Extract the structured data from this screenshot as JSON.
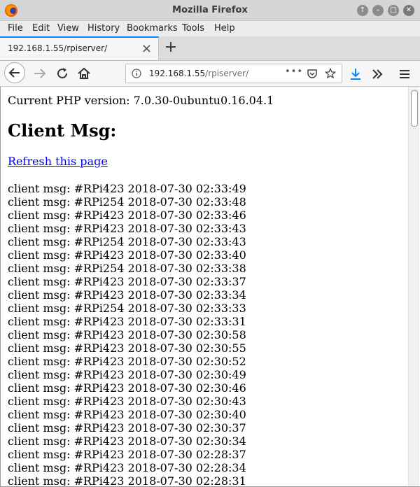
{
  "window": {
    "title": "Mozilla Firefox"
  },
  "menu": [
    "File",
    "Edit",
    "View",
    "History",
    "Bookmarks",
    "Tools",
    "Help"
  ],
  "tab": {
    "label": "192.168.1.55/rpiserver/"
  },
  "urlbar": {
    "host": "192.168.1.55",
    "path": "/rpiserver/",
    "more": "•••"
  },
  "page": {
    "php_version": "Current PHP version: 7.0.30-0ubuntu0.16.04.1",
    "heading": "Client Msg:",
    "refresh_link": "Refresh this page",
    "messages": [
      "client msg: #RPi423 2018-07-30 02:33:49",
      "client msg: #RPi254 2018-07-30 02:33:48",
      "client msg: #RPi423 2018-07-30 02:33:46",
      "client msg: #RPi423 2018-07-30 02:33:43",
      "client msg: #RPi254 2018-07-30 02:33:43",
      "client msg: #RPi423 2018-07-30 02:33:40",
      "client msg: #RPi254 2018-07-30 02:33:38",
      "client msg: #RPi423 2018-07-30 02:33:37",
      "client msg: #RPi423 2018-07-30 02:33:34",
      "client msg: #RPi254 2018-07-30 02:33:33",
      "client msg: #RPi423 2018-07-30 02:33:31",
      "client msg: #RPi423 2018-07-30 02:30:58",
      "client msg: #RPi423 2018-07-30 02:30:55",
      "client msg: #RPi423 2018-07-30 02:30:52",
      "client msg: #RPi423 2018-07-30 02:30:49",
      "client msg: #RPi423 2018-07-30 02:30:46",
      "client msg: #RPi423 2018-07-30 02:30:43",
      "client msg: #RPi423 2018-07-30 02:30:40",
      "client msg: #RPi423 2018-07-30 02:30:37",
      "client msg: #RPi423 2018-07-30 02:30:34",
      "client msg: #RPi423 2018-07-30 02:28:37",
      "client msg: #RPi423 2018-07-30 02:28:34",
      "client msg: #RPi423 2018-07-30 02:28:31"
    ]
  },
  "icons": {
    "app": "firefox-logo-icon",
    "window_controls": [
      "window-up-icon",
      "minimize-icon",
      "maximize-icon",
      "close-icon"
    ],
    "nav": [
      "back-icon",
      "forward-icon",
      "reload-icon",
      "home-icon"
    ],
    "url": [
      "info-icon",
      "page-actions-icon",
      "pocket-icon",
      "bookmark-star-icon"
    ],
    "toolbar": [
      "download-icon",
      "overflow-icon",
      "hamburger-menu-icon"
    ]
  },
  "colors": {
    "link": "#0000ee",
    "tab_accent": "#0a84ff",
    "download": "#0a84ff"
  }
}
